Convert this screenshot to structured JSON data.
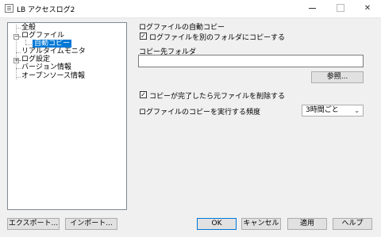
{
  "window": {
    "title": "LB アクセスログ2",
    "min_symbol": "—",
    "max_symbol": "☐",
    "close_symbol": "✕"
  },
  "tree": {
    "items": [
      {
        "label": "全般"
      },
      {
        "label": "ログファイル",
        "expander": "−"
      },
      {
        "label": "自動コピー",
        "selected": true
      },
      {
        "label": "リアルタイムモニタ"
      },
      {
        "label": "ログ設定",
        "expander": "+"
      },
      {
        "label": "バージョン情報"
      },
      {
        "label": "オープンソース情報"
      }
    ]
  },
  "panel": {
    "section_title": "ログファイルの自動コピー",
    "copy_checkbox_label": "ログファイルを別のフォルダにコピーする",
    "copy_checked": true,
    "dest_label": "コピー先フォルダ",
    "dest_value": "",
    "browse_label": "参照...",
    "delete_checkbox_label": "コピーが完了したら元ファイルを削除する",
    "delete_checked": true,
    "frequency_label": "ログファイルのコピーを実行する頻度",
    "frequency_value": "3時間ごと"
  },
  "footer": {
    "export_label": "エクスポート...",
    "import_label": "インポート...",
    "ok_label": "OK",
    "cancel_label": "キャンセル",
    "apply_label": "適用",
    "help_label": "ヘルプ"
  },
  "colors": {
    "selection": "#0078d7",
    "background": "#f0f0f0"
  }
}
